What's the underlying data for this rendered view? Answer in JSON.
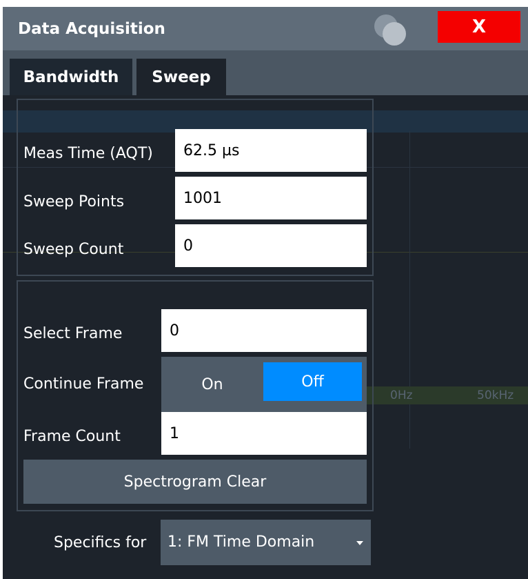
{
  "window": {
    "title": "Data Acquisition",
    "close_label": "X",
    "close_color": "#f40000"
  },
  "tabs": [
    {
      "label": "Bandwidth",
      "active": false
    },
    {
      "label": "Sweep",
      "active": true
    }
  ],
  "sweep_group": {
    "meas_time": {
      "label": "Meas Time (AQT)",
      "value": "62.5 µs"
    },
    "sweep_points": {
      "label": "Sweep Points",
      "value": "1001"
    },
    "sweep_count": {
      "label": "Sweep Count",
      "value": "0"
    }
  },
  "spectrogram_group": {
    "select_frame": {
      "label": "Select Frame",
      "value": "0"
    },
    "continue_frame": {
      "label": "Continue Frame",
      "on_label": "On",
      "off_label": "Off",
      "selected": "Off"
    },
    "frame_count": {
      "label": "Frame Count",
      "value": "1"
    },
    "clear_button": "Spectrogram Clear"
  },
  "specifics": {
    "label": "Specifics for",
    "selected": "1: FM Time Domain"
  },
  "background": {
    "freq_label_1": "0Hz",
    "freq_label_2": "50kHz"
  },
  "colors": {
    "accent": "#008cff",
    "titlebar": "#5f6c79",
    "panel": "#1d232b"
  }
}
